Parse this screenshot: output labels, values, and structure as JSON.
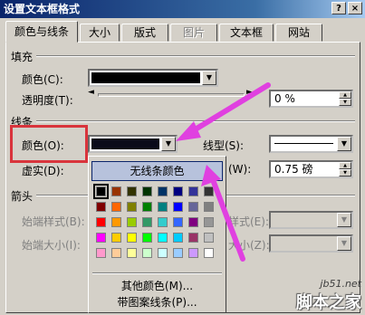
{
  "window": {
    "title": "设置文本框格式",
    "help_btn": "?",
    "close_btn": "×"
  },
  "tabs": [
    {
      "label": "颜色与线条",
      "state": "active"
    },
    {
      "label": "大小",
      "state": "normal"
    },
    {
      "label": "版式",
      "state": "normal"
    },
    {
      "label": "图片",
      "state": "disabled"
    },
    {
      "label": "文本框",
      "state": "normal"
    },
    {
      "label": "网站",
      "state": "normal"
    }
  ],
  "fill": {
    "section_label": "填充",
    "color_label": "颜色(C):",
    "color_value": "#000000",
    "transparency_label": "透明度(T):",
    "slider_left": "◄",
    "slider_right": "►",
    "transparency_value": "0 %"
  },
  "line": {
    "section_label": "线条",
    "color_label": "颜色(O):",
    "color_value": "#000000",
    "style_label": "线型(S):",
    "dash_label": "虚实(D):",
    "weight_label": "(W):",
    "weight_value": "0.75 磅"
  },
  "arrows": {
    "section_label": "箭头",
    "begin_style_label": "始端样式(B):",
    "begin_size_label": "始端大小(I):",
    "end_style_label": "样式(E):",
    "end_size_label": "大小(Z):"
  },
  "color_popup": {
    "no_line_label": "无线条颜色",
    "palette": [
      [
        "#000000",
        "#993300",
        "#333300",
        "#003300",
        "#003366",
        "#000080",
        "#333399",
        "#333333"
      ],
      [
        "#800000",
        "#ff6600",
        "#808000",
        "#008000",
        "#008080",
        "#0000ff",
        "#666699",
        "#808080"
      ],
      [
        "#ff0000",
        "#ff9900",
        "#99cc00",
        "#339966",
        "#33cccc",
        "#3366ff",
        "#800080",
        "#969696"
      ],
      [
        "#ff00ff",
        "#ffcc00",
        "#ffff00",
        "#00ff00",
        "#00ffff",
        "#00ccff",
        "#993366",
        "#c0c0c0"
      ],
      [
        "#ff99cc",
        "#ffcc99",
        "#ffff99",
        "#ccffcc",
        "#ccffff",
        "#99ccff",
        "#cc99ff",
        "#ffffff"
      ]
    ],
    "more_colors_label": "其他颜色(M)...",
    "patterned_lines_label": "带图案线条(P)..."
  },
  "watermark": {
    "line1": "jb51.net",
    "line2": "脚本之家"
  },
  "colors": {
    "highlight_box": "#d9343c",
    "arrow": "#e040e0",
    "selected_item_bg": "#b7c2dc"
  }
}
